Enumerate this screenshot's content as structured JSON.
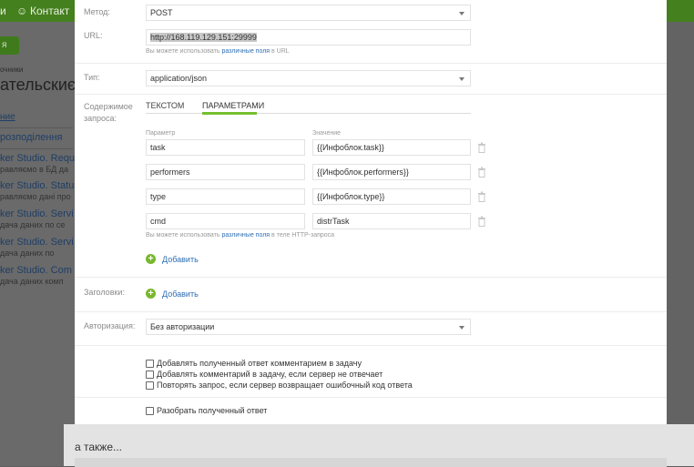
{
  "background": {
    "nav_items": [
      "и",
      "Контакт"
    ],
    "button_label": "я",
    "breadcrumb": "очники",
    "title": "ательскиє",
    "section": "ние",
    "items": [
      {
        "title": "розподілення",
        "sub": ""
      },
      {
        "title": "ker Studio. Requ",
        "sub": "равляємо в БД да"
      },
      {
        "title": "ker Studio. Status",
        "sub": "равляємо дані про"
      },
      {
        "title": "ker Studio. Servi",
        "sub": "дача даних по се"
      },
      {
        "title": "ker Studio. Servi",
        "sub": "дача даних по"
      },
      {
        "title": "ker Studio. Com",
        "sub": "дача даних комп"
      }
    ]
  },
  "form": {
    "method": {
      "label": "Метод:",
      "value": "POST"
    },
    "url": {
      "label": "URL:",
      "value": "http://168.119.129.151:29999",
      "hint_before": "Вы можете использовать ",
      "hint_link": "различные поля",
      "hint_after": " в URL"
    },
    "type": {
      "label": "Тип:",
      "value": "application/json"
    },
    "body": {
      "label": "Содержимое запроса:",
      "tab_text": "ТЕКСТОМ",
      "tab_params": "ПАРАМЕТРАМИ",
      "col_param": "Параметр",
      "col_value": "Значение",
      "params": [
        {
          "name": "task",
          "value": "{{Инфоблок.task}}"
        },
        {
          "name": "performers",
          "value": "{{Инфоблок.performers}}"
        },
        {
          "name": "type",
          "value": "{{Инфоблок.type}}"
        },
        {
          "name": "cmd",
          "value": "distrTask"
        }
      ],
      "hint_before": "Вы можете использовать ",
      "hint_link": "различные поля",
      "hint_after": " в теле HTTP-запроса",
      "add_label": "Добавить"
    },
    "headers": {
      "label": "Заголовки:",
      "add_label": "Добавить"
    },
    "auth": {
      "label": "Авторизация:",
      "value": "Без авторизации"
    },
    "checkboxes": [
      {
        "label": "Добавлять полученный ответ комментарием в задачу",
        "checked": false
      },
      {
        "label": "Добавлять комментарий в задачу, если сервер не отвечает",
        "checked": false
      },
      {
        "label": "Повторять запрос, если сервер возвращает ошибочный код ответа",
        "checked": false
      }
    ],
    "parse": {
      "label": "Разобрать полученный ответ",
      "checked": false
    }
  },
  "footer": {
    "also": "а также..."
  },
  "colors": {
    "accent_green": "#76bf2f",
    "link_blue": "#2f6fb3",
    "topbar_green": "#45801f"
  }
}
